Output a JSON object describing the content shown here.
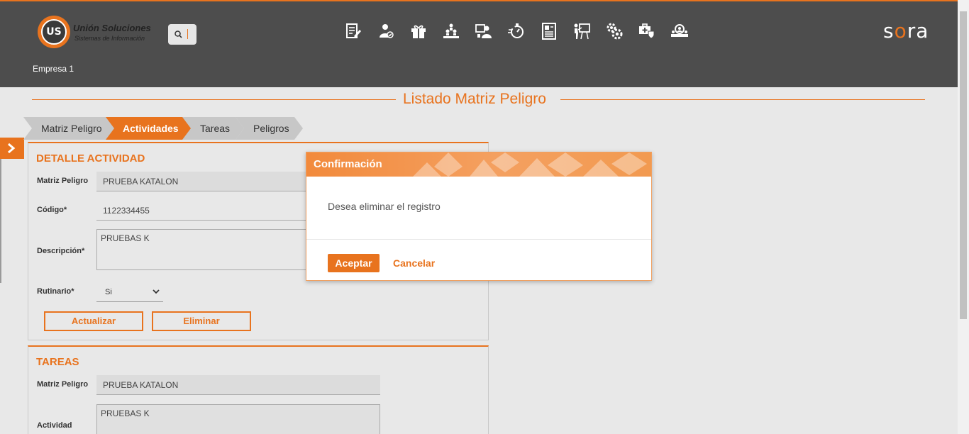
{
  "header": {
    "logo_title": "Unión Soluciones",
    "logo_subtitle": "Sistemas de Información",
    "logo_mark": "US",
    "brand_left": "s",
    "brand_o": "o",
    "brand_right": "ra",
    "company": "Empresa 1",
    "nav_icons": [
      "document-edit-icon",
      "user-check-icon",
      "gift-icon",
      "team-pyramid-icon",
      "user-board-icon",
      "stopwatch-icon",
      "id-card-icon",
      "presenter-icon",
      "gears-icon",
      "shield-medkit-icon",
      "group-search-icon"
    ]
  },
  "page": {
    "title": "Listado Matriz Peligro"
  },
  "breadcrumbs": [
    {
      "label": "Matriz Peligro"
    },
    {
      "label": "Actividades"
    },
    {
      "label": "Tareas"
    },
    {
      "label": "Peligros"
    }
  ],
  "detalle": {
    "title": "DETALLE ACTIVIDAD",
    "matriz_label": "Matriz Peligro",
    "matriz_value": "PRUEBA KATALON",
    "codigo_label": "Código*",
    "codigo_value": "1122334455",
    "descripcion_label": "Descripción*",
    "descripcion_value": "PRUEBAS K",
    "rutinario_label": "Rutinario*",
    "rutinario_value": "Si",
    "btn_update": "Actualizar",
    "btn_delete": "Eliminar"
  },
  "tareas": {
    "title": "TAREAS",
    "matriz_label": "Matriz Peligro",
    "matriz_value": "PRUEBA KATALON",
    "actividad_label": "Actividad",
    "actividad_value": "PRUEBAS K"
  },
  "modal": {
    "title": "Confirmación",
    "message": "Desea eliminar el registro",
    "accept": "Aceptar",
    "cancel": "Cancelar"
  },
  "colors": {
    "accent": "#e8731e",
    "header_bg": "#4d4d4d",
    "page_bg": "#e8e8e8"
  }
}
